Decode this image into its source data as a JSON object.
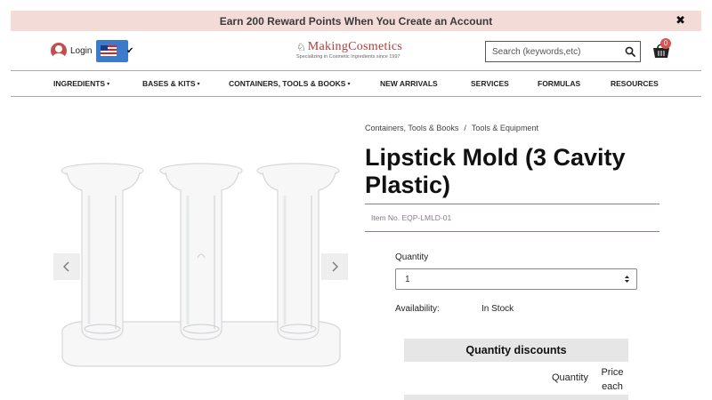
{
  "promo": {
    "text": "Earn 200 Reward Points When You Create an Account",
    "close": "✖"
  },
  "header": {
    "login_label": "Login",
    "logo_name": "MakingCosmetics",
    "logo_tagline": "Specializing in Cosmetic Ingredients since 1997",
    "search_placeholder": "Search (keywords,etc)",
    "cart_count": "0"
  },
  "nav": {
    "items": [
      {
        "label": "INGREDIENTS",
        "dropdown": true
      },
      {
        "label": "BASES & KITS",
        "dropdown": true
      },
      {
        "label": "CONTAINERS, TOOLS & BOOKS",
        "dropdown": true
      },
      {
        "label": "NEW ARRIVALS",
        "dropdown": false
      },
      {
        "label": "SERVICES",
        "dropdown": false
      },
      {
        "label": "FORMULAS",
        "dropdown": false
      },
      {
        "label": "RESOURCES",
        "dropdown": false
      }
    ],
    "caret": "▾"
  },
  "breadcrumb": {
    "items": [
      "Containers, Tools & Books",
      "Tools & Equipment"
    ],
    "separator": "/"
  },
  "product": {
    "title": "Lipstick Mold (3 Cavity Plastic)",
    "item_no": "Item No. EQP-LMLD-01",
    "quantity_label": "Quantity",
    "quantity_value": "1",
    "availability_label": "Availability:",
    "availability_value": "In Stock"
  },
  "discounts": {
    "heading": "Quantity discounts",
    "col_quantity": "Quantity",
    "col_price": "Price each"
  },
  "colors": {
    "promo_bg": "#f3dcd8",
    "accent_red": "#c0504d",
    "sku_line": "#8e7a99",
    "flag_bg": "#3c7bc9"
  },
  "icons": [
    "user-icon",
    "us-flag-icon",
    "check-icon",
    "search-icon",
    "cart-icon",
    "chevron-left-icon",
    "chevron-right-icon",
    "updown-icon",
    "close-icon"
  ]
}
